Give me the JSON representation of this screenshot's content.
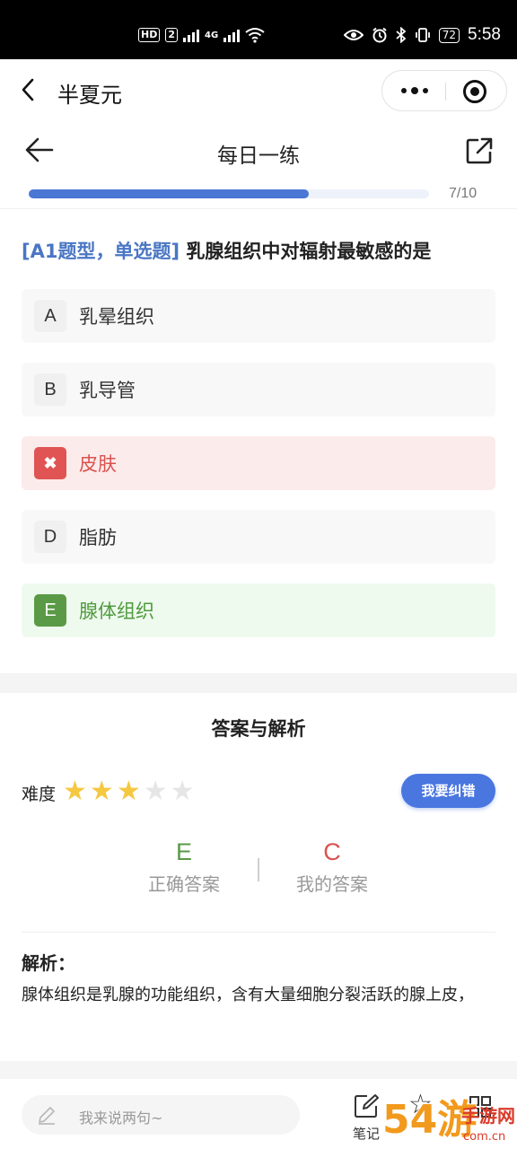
{
  "status_bar": {
    "net1": "HD",
    "net2": "2",
    "net3": "4G",
    "battery": "72",
    "time": "5:58"
  },
  "app": {
    "title": "半夏元"
  },
  "page": {
    "title": "每日一练",
    "progress_fraction": 0.7,
    "progress_text": "7/10"
  },
  "question": {
    "type": "[A1题型，单选题]",
    "text": "乳腺组织中对辐射最敏感的是",
    "options": [
      {
        "letter": "A",
        "text": "乳晕组织",
        "state": "normal"
      },
      {
        "letter": "B",
        "text": "乳导管",
        "state": "normal"
      },
      {
        "letter": "✖",
        "text": "皮肤",
        "state": "wrong"
      },
      {
        "letter": "D",
        "text": "脂肪",
        "state": "normal"
      },
      {
        "letter": "E",
        "text": "腺体组织",
        "state": "correct"
      }
    ]
  },
  "analysis": {
    "title": "答案与解析",
    "difficulty_label": "难度",
    "difficulty_stars": 3,
    "difficulty_max": 5,
    "report_button": "我要纠错",
    "correct_answer": "E",
    "correct_label": "正确答案",
    "my_answer": "C",
    "my_label": "我的答案",
    "explanation_title": "解析：",
    "explanation_text": "腺体组织是乳腺的功能组织，含有大量细胞分裂活跃的腺上皮，"
  },
  "bottom_bar": {
    "comment_placeholder": "我来说两句~",
    "note_label": "笔记"
  },
  "watermark": {
    "text": "54游手游网",
    "domain": "com.cn"
  },
  "colors": {
    "accent": "#4a76e0",
    "correct": "#5a9a46",
    "wrong": "#d9534f",
    "star_on": "#f5c842"
  }
}
